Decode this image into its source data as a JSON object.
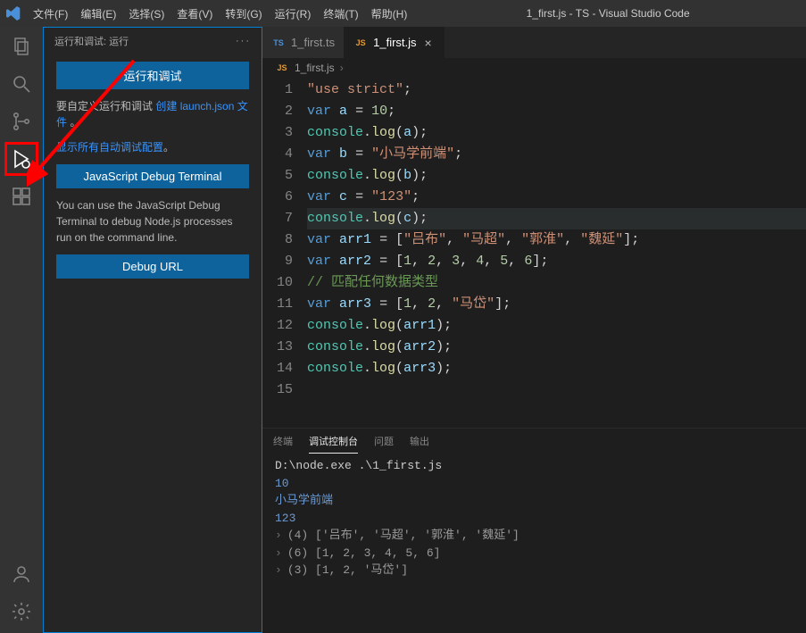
{
  "titlebar": {
    "menus": [
      "文件(F)",
      "编辑(E)",
      "选择(S)",
      "查看(V)",
      "转到(G)",
      "运行(R)",
      "终端(T)",
      "帮助(H)"
    ],
    "title": "1_first.js - TS - Visual Studio Code"
  },
  "sidebar": {
    "header": "运行和调试: 运行",
    "run_button": "运行和调试",
    "customize_pre": "要自定义运行和调试",
    "launch_link": "创建 launch.json 文件",
    "customize_post": "。",
    "show_all_link": "显示所有自动调试配置",
    "show_all_post": "。",
    "jsdt_button": "JavaScript Debug Terminal",
    "jsdt_desc": "You can use the JavaScript Debug Terminal to debug Node.js processes run on the command line.",
    "debug_url_button": "Debug URL"
  },
  "tabs": [
    {
      "icon": "TS",
      "label": "1_first.ts",
      "active": false,
      "close": false
    },
    {
      "icon": "JS",
      "label": "1_first.js",
      "active": true,
      "close": true
    }
  ],
  "breadcrumb": {
    "icon": "JS",
    "file": "1_first.js",
    "sep": "›"
  },
  "code_lines": [
    {
      "html": "<span class='s'>\"use strict\"</span><span class='o'>;</span>"
    },
    {
      "html": "<span class='k'>var</span> <span class='i'>a</span> <span class='o'>=</span> <span class='n'>10</span><span class='o'>;</span>"
    },
    {
      "html": "<span class='g'>console</span><span class='o'>.</span><span class='f'>log</span><span class='o'>(</span><span class='i'>a</span><span class='o'>);</span>"
    },
    {
      "html": "<span class='k'>var</span> <span class='i'>b</span> <span class='o'>=</span> <span class='s'>\"小马学前端\"</span><span class='o'>;</span>"
    },
    {
      "html": "<span class='g'>console</span><span class='o'>.</span><span class='f'>log</span><span class='o'>(</span><span class='i'>b</span><span class='o'>);</span>"
    },
    {
      "html": "<span class='k'>var</span> <span class='i'>c</span> <span class='o'>=</span> <span class='s'>\"123\"</span><span class='o'>;</span>"
    },
    {
      "html": "<span class='g'>console</span><span class='o'>.</span><span class='f'>log</span><span class='o'>(</span><span class='i'>c</span><span class='o'>);</span>",
      "hl": true
    },
    {
      "html": "<span class='k'>var</span> <span class='i'>arr1</span> <span class='o'>= [</span><span class='s'>\"吕布\"</span><span class='o'>,</span> <span class='s'>\"马超\"</span><span class='o'>,</span> <span class='s'>\"郭淮\"</span><span class='o'>,</span> <span class='s'>\"魏延\"</span><span class='o'>];</span>"
    },
    {
      "html": "<span class='k'>var</span> <span class='i'>arr2</span> <span class='o'>= [</span><span class='n'>1</span><span class='o'>,</span> <span class='n'>2</span><span class='o'>,</span> <span class='n'>3</span><span class='o'>,</span> <span class='n'>4</span><span class='o'>,</span> <span class='n'>5</span><span class='o'>,</span> <span class='n'>6</span><span class='o'>];</span>"
    },
    {
      "html": "<span class='c'>// 匹配任何数据类型</span>"
    },
    {
      "html": "<span class='k'>var</span> <span class='i'>arr3</span> <span class='o'>= [</span><span class='n'>1</span><span class='o'>,</span> <span class='n'>2</span><span class='o'>,</span> <span class='s'>\"马岱\"</span><span class='o'>];</span>"
    },
    {
      "html": "<span class='g'>console</span><span class='o'>.</span><span class='f'>log</span><span class='o'>(</span><span class='i'>arr1</span><span class='o'>);</span>"
    },
    {
      "html": "<span class='g'>console</span><span class='o'>.</span><span class='f'>log</span><span class='o'>(</span><span class='i'>arr2</span><span class='o'>);</span>"
    },
    {
      "html": "<span class='g'>console</span><span class='o'>.</span><span class='f'>log</span><span class='o'>(</span><span class='i'>arr3</span><span class='o'>);</span>"
    },
    {
      "html": ""
    }
  ],
  "panel": {
    "tabs": [
      "终端",
      "调试控制台",
      "问题",
      "输出"
    ],
    "active_tab": 1,
    "cmd": "D:\\node.exe .\\1_first.js",
    "out_simple": [
      "10",
      "小马学前端",
      "123"
    ],
    "out_expand": [
      {
        "label": "(4)",
        "body": "['吕布', '马超', '郭淮', '魏延']"
      },
      {
        "label": "(6)",
        "body": "[1, 2, 3, 4, 5, 6]"
      },
      {
        "label": "(3)",
        "body": "[1, 2, '马岱']"
      }
    ]
  }
}
